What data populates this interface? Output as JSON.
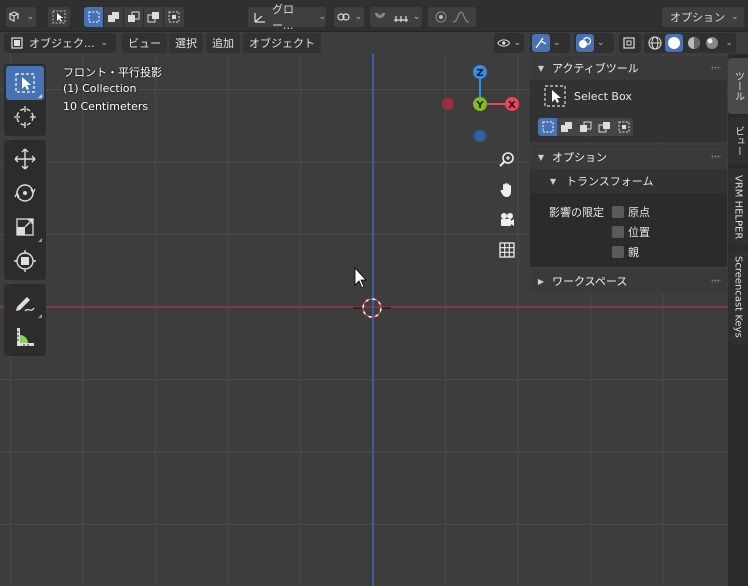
{
  "topbar": {
    "transform_orientation": "グロー...",
    "options_label": "オプション"
  },
  "viewport_header": {
    "mode_label": "オブジェク...",
    "menus": [
      "ビュー",
      "選択",
      "追加",
      "オブジェクト"
    ]
  },
  "overlay": {
    "view_name": "フロント・平行投影",
    "collection": "(1) Collection",
    "grid_scale": "10 Centimeters"
  },
  "gizmo": {
    "z": "Z",
    "y": "Y",
    "x": "X"
  },
  "sidebar": {
    "active_tool": {
      "title": "アクティブツール",
      "tool_name": "Select Box"
    },
    "options": {
      "title": "オプション",
      "transform_title": "トランスフォーム",
      "limit_label": "影響の限定",
      "checks": [
        "原点",
        "位置",
        "親"
      ]
    },
    "workspace": {
      "title": "ワークスペース"
    }
  },
  "tabs": [
    "ツール",
    "ビュー",
    "VRM HELPER",
    "Screencast Keys"
  ],
  "colors": {
    "active_blue": "#4772b3",
    "axis_x": "#e8455c",
    "axis_y": "#83ba1f",
    "axis_z": "#3d8be0"
  }
}
